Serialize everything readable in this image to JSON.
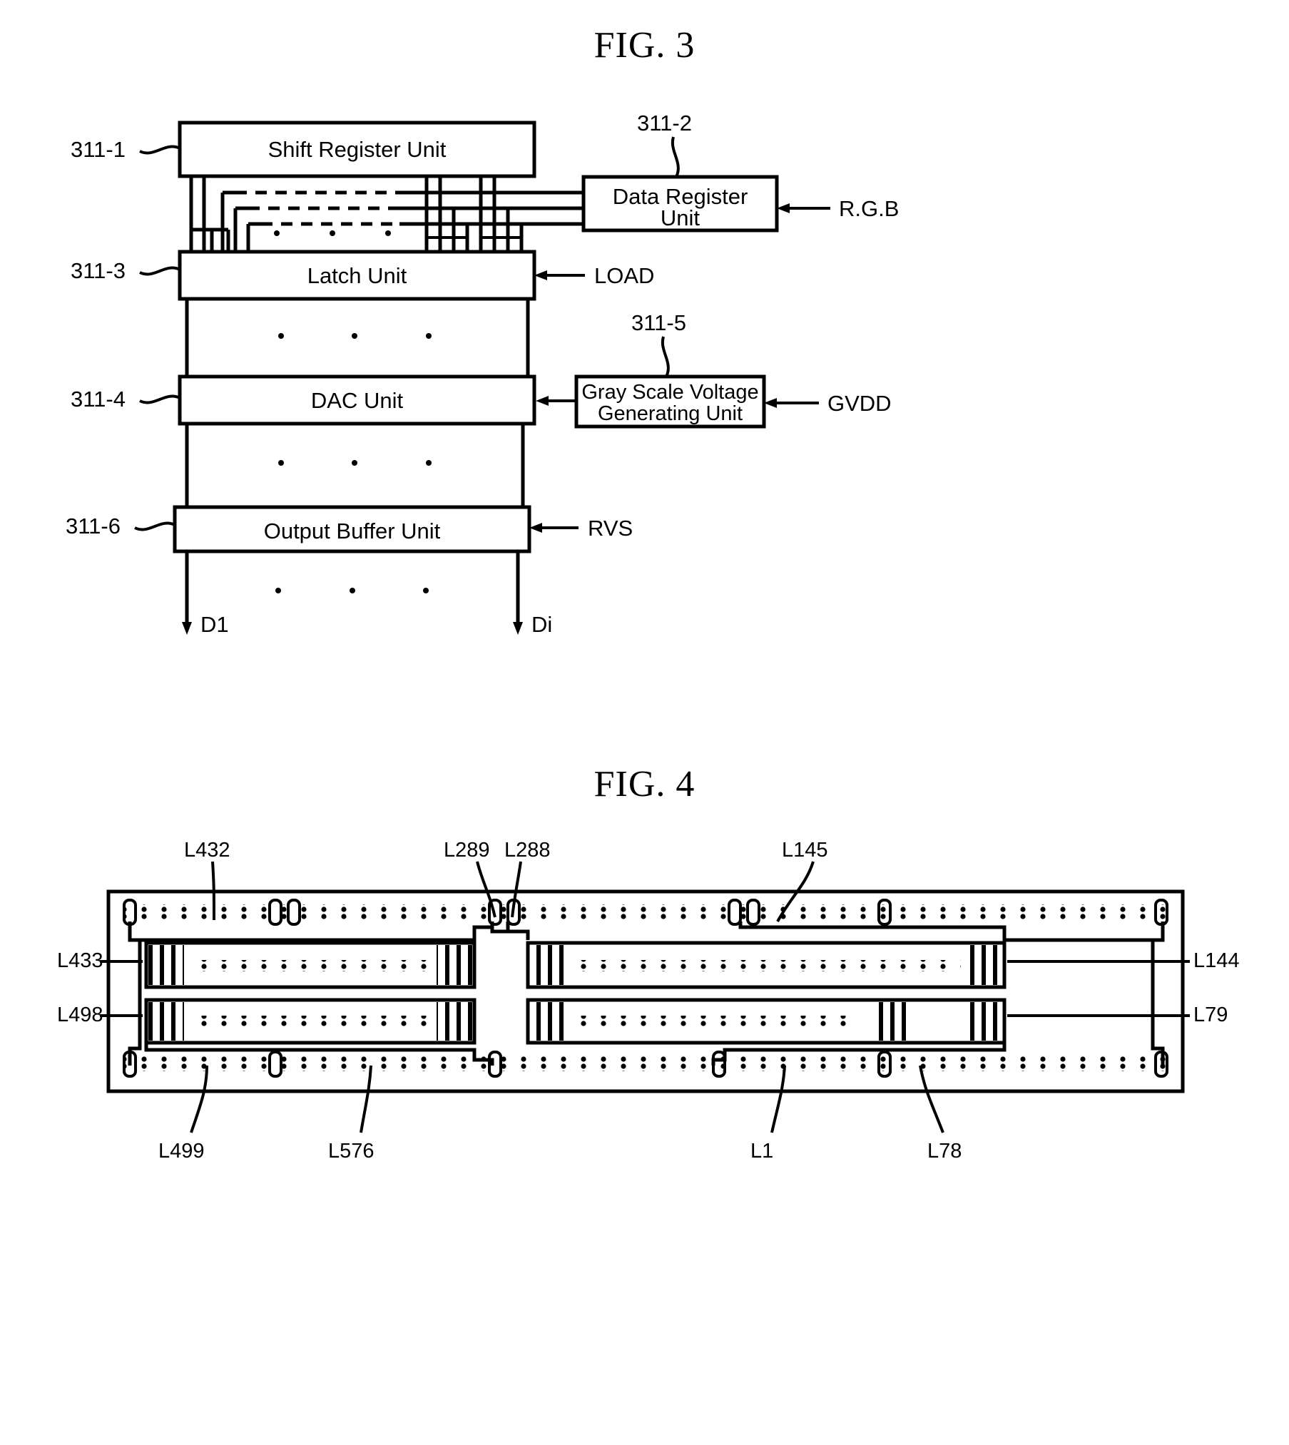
{
  "figures": [
    {
      "id": "fig3",
      "title": "FIG. 3",
      "type": "block-diagram",
      "blocks": [
        {
          "ref": "311-1",
          "label": "Shift Register Unit"
        },
        {
          "ref": "311-2",
          "label": "Data Register\nUnit"
        },
        {
          "ref": "311-3",
          "label": "Latch Unit"
        },
        {
          "ref": "311-4",
          "label": "DAC Unit"
        },
        {
          "ref": "311-5",
          "label": "Gray Scale Voltage\nGenerating Unit"
        },
        {
          "ref": "311-6",
          "label": "Output Buffer Unit"
        }
      ],
      "block_titles": {
        "shift_register": "Shift Register Unit",
        "data_register_line1": "Data Register",
        "data_register_line2": "Unit",
        "latch": "Latch Unit",
        "dac": "DAC Unit",
        "gray_scale_line1": "Gray Scale Voltage",
        "gray_scale_line2": "Generating Unit",
        "output_buffer": "Output Buffer Unit"
      },
      "refs": {
        "shift_register": "311-1",
        "data_register": "311-2",
        "latch": "311-3",
        "dac": "311-4",
        "gray_scale": "311-5",
        "output_buffer": "311-6"
      },
      "signals": [
        {
          "name": "R.G.B",
          "target": "311-2"
        },
        {
          "name": "LOAD",
          "target": "311-3"
        },
        {
          "name": "GVDD",
          "target": "311-5"
        },
        {
          "name": "RVS",
          "target": "311-6"
        }
      ],
      "signal_labels": {
        "rgb": "R.G.B",
        "load": "LOAD",
        "gvdd": "GVDD",
        "rvs": "RVS"
      },
      "outputs": [
        {
          "name": "D1"
        },
        {
          "name": "Di"
        }
      ],
      "output_labels": {
        "first": "D1",
        "last": "Di"
      }
    },
    {
      "id": "fig4",
      "title": "FIG. 4",
      "type": "layout-diagram",
      "line_labels": {
        "top_left": "L432",
        "top_mid_left": "L289",
        "top_mid_right": "L288",
        "top_right": "L145",
        "left_upper": "L433",
        "left_lower": "L498",
        "right_upper": "L144",
        "right_lower": "L79",
        "bottom_left": "L499",
        "bottom_mid_left": "L576",
        "bottom_mid_right": "L1",
        "bottom_right": "L78"
      }
    }
  ]
}
